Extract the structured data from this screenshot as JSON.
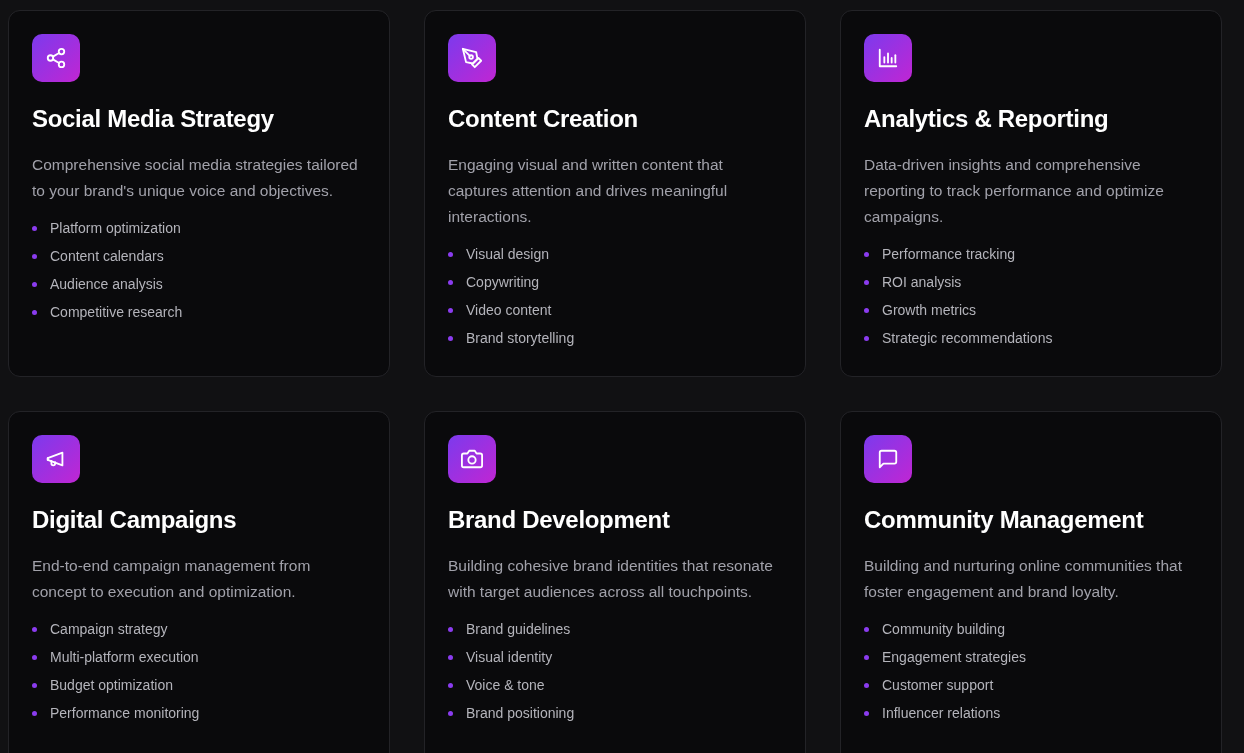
{
  "services": [
    {
      "kind": "share",
      "title": "Social Media Strategy",
      "description": "Comprehensive social media strategies tailored to your brand's unique voice and objectives.",
      "features": [
        "Platform optimization",
        "Content calendars",
        "Audience analysis",
        "Competitive research"
      ]
    },
    {
      "kind": "pen",
      "title": "Content Creation",
      "description": "Engaging visual and written content that captures attention and drives meaningful interactions.",
      "features": [
        "Visual design",
        "Copywriting",
        "Video content",
        "Brand storytelling"
      ]
    },
    {
      "kind": "chart",
      "title": "Analytics & Reporting",
      "description": "Data-driven insights and comprehensive reporting to track performance and optimize campaigns.",
      "features": [
        "Performance tracking",
        "ROI analysis",
        "Growth metrics",
        "Strategic recommendations"
      ]
    },
    {
      "kind": "megaphone",
      "title": "Digital Campaigns",
      "description": "End-to-end campaign management from concept to execution and optimization.",
      "features": [
        "Campaign strategy",
        "Multi-platform execution",
        "Budget optimization",
        "Performance monitoring"
      ]
    },
    {
      "kind": "camera",
      "title": "Brand Development",
      "description": "Building cohesive brand identities that resonate with target audiences across all touchpoints.",
      "features": [
        "Brand guidelines",
        "Visual identity",
        "Voice & tone",
        "Brand positioning"
      ]
    },
    {
      "kind": "message",
      "title": "Community Management",
      "description": "Building and nurturing online communities that foster engagement and brand loyalty.",
      "features": [
        "Community building",
        "Engagement strategies",
        "Customer support",
        "Influencer relations"
      ]
    }
  ]
}
